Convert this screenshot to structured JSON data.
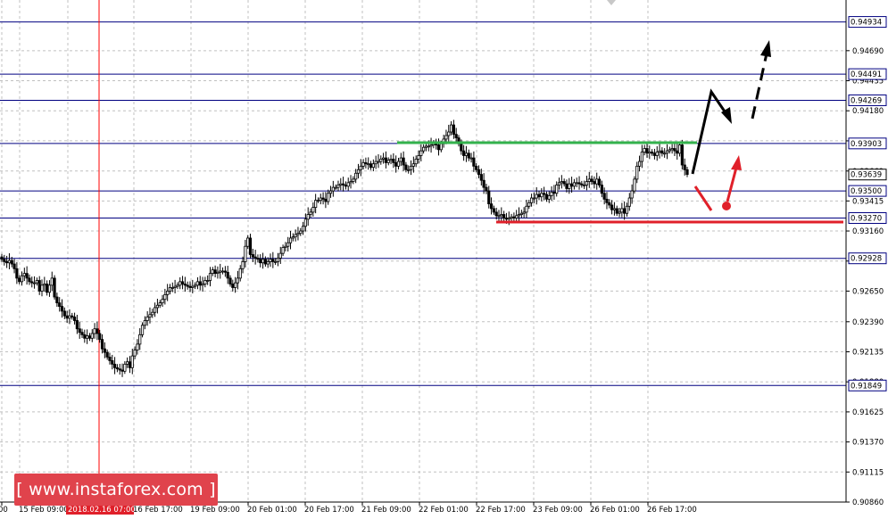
{
  "chart_data": {
    "type": "candlestick",
    "instrument_note": "",
    "watermark": "[ www.instaforex.com ]",
    "y_range": [
      0.9086,
      0.9512
    ],
    "price_ticks": [
      "0.94690",
      "0.94435",
      "0.94180",
      "0.93925",
      "0.93669",
      "0.93415",
      "0.93160",
      "0.92905",
      "0.92650",
      "0.92390",
      "0.92135",
      "0.91880",
      "0.91625",
      "0.91370",
      "0.91115",
      "0.90860"
    ],
    "time_ticks": [
      "00",
      "15 Feb 09:00",
      "2018.02.16 07:00",
      "16 Feb 17:00",
      "19 Feb 09:00",
      "20 Feb 01:00",
      "20 Feb 17:00",
      "21 Feb 09:00",
      "22 Feb 01:00",
      "22 Feb 17:00",
      "23 Feb 09:00",
      "26 Feb 01:00",
      "26 Feb 17:00"
    ],
    "highlighted_time": "2018.02.16 07:00",
    "levels": [
      {
        "price": 0.94934,
        "label": "0.94934"
      },
      {
        "price": 0.94491,
        "label": "0.94491"
      },
      {
        "price": 0.94269,
        "label": "0.94269"
      },
      {
        "price": 0.93903,
        "label": "0.93903"
      },
      {
        "price": 0.93639,
        "label": "0.93639",
        "current": true
      },
      {
        "price": 0.935,
        "label": "0.93500"
      },
      {
        "price": 0.9327,
        "label": "0.93270"
      },
      {
        "price": 0.92928,
        "label": "0.92928"
      },
      {
        "price": 0.91849,
        "label": "0.91849"
      }
    ],
    "close_series": [
      0.9292,
      0.929,
      0.9289,
      0.9291,
      0.9288,
      0.9284,
      0.9276,
      0.9273,
      0.9278,
      0.928,
      0.9276,
      0.9273,
      0.9272,
      0.9272,
      0.9274,
      0.9265,
      0.927,
      0.9271,
      0.9264,
      0.927,
      0.9276,
      0.926,
      0.9255,
      0.9252,
      0.9248,
      0.9244,
      0.9242,
      0.9244,
      0.9243,
      0.924,
      0.9233,
      0.923,
      0.9228,
      0.9225,
      0.9227,
      0.9225,
      0.9229,
      0.9233,
      0.9229,
      0.9224,
      0.9216,
      0.9213,
      0.9209,
      0.9206,
      0.9203,
      0.92,
      0.9199,
      0.9198,
      0.9197,
      0.9203,
      0.9205,
      0.92,
      0.921,
      0.9215,
      0.922,
      0.9228,
      0.9236,
      0.924,
      0.9243,
      0.9245,
      0.9247,
      0.9251,
      0.9253,
      0.9255,
      0.9258,
      0.9262,
      0.9265,
      0.9268,
      0.9268,
      0.9269,
      0.927,
      0.9273,
      0.9271,
      0.927,
      0.9269,
      0.9268,
      0.9269,
      0.927,
      0.9273,
      0.927,
      0.9271,
      0.9274,
      0.9274,
      0.928,
      0.9283,
      0.928,
      0.9281,
      0.9282,
      0.9282,
      0.9281,
      0.9276,
      0.9271,
      0.9268,
      0.9272,
      0.9276,
      0.9284,
      0.929,
      0.9303,
      0.931,
      0.9296,
      0.9294,
      0.9293,
      0.9292,
      0.9289,
      0.9292,
      0.9288,
      0.929,
      0.9292,
      0.929,
      0.929,
      0.9293,
      0.9297,
      0.9302,
      0.9303,
      0.9306,
      0.931,
      0.9311,
      0.9313,
      0.9314,
      0.9316,
      0.932,
      0.9326,
      0.933,
      0.9332,
      0.9336,
      0.9342,
      0.9342,
      0.9344,
      0.9343,
      0.9341,
      0.9348,
      0.935,
      0.9353,
      0.9353,
      0.9355,
      0.9356,
      0.9355,
      0.9354,
      0.9357,
      0.9358,
      0.936,
      0.9365,
      0.9368,
      0.9371,
      0.9374,
      0.9373,
      0.9373,
      0.937,
      0.9373,
      0.9375,
      0.9375,
      0.9377,
      0.9378,
      0.9374,
      0.9376,
      0.9377,
      0.9374,
      0.9371,
      0.9375,
      0.9378,
      0.9372,
      0.9368,
      0.9368,
      0.9371,
      0.9373,
      0.9377,
      0.938,
      0.9384,
      0.9387,
      0.9388,
      0.9388,
      0.9389,
      0.939,
      0.9389,
      0.9385,
      0.939,
      0.9394,
      0.9397,
      0.94,
      0.9406,
      0.9398,
      0.9395,
      0.939,
      0.9384,
      0.938,
      0.9382,
      0.9378,
      0.9378,
      0.9371,
      0.9368,
      0.9364,
      0.9359,
      0.9353,
      0.935,
      0.9339,
      0.9335,
      0.9332,
      0.9329,
      0.9329,
      0.933,
      0.9327,
      0.9326,
      0.9327,
      0.9328,
      0.9327,
      0.9329,
      0.933,
      0.9331,
      0.9332,
      0.9337,
      0.934,
      0.9344,
      0.9344,
      0.9347,
      0.9345,
      0.9348,
      0.9347,
      0.9343,
      0.9346,
      0.9349,
      0.9348,
      0.9355,
      0.9357,
      0.9358,
      0.9356,
      0.9352,
      0.9356,
      0.9354,
      0.9357,
      0.9357,
      0.9356,
      0.9355,
      0.9355,
      0.9358,
      0.936,
      0.9358,
      0.9356,
      0.936,
      0.9355,
      0.9348,
      0.9343,
      0.934,
      0.9338,
      0.9334,
      0.9335,
      0.9331,
      0.9332,
      0.9335,
      0.9331,
      0.9337,
      0.9344,
      0.935,
      0.936,
      0.9371,
      0.9375,
      0.9383,
      0.9386,
      0.9382,
      0.9383,
      0.9382,
      0.938,
      0.9383,
      0.9384,
      0.9382,
      0.9382,
      0.9384,
      0.9385,
      0.9386,
      0.9384,
      0.9382,
      0.9389,
      0.9372,
      0.9368,
      0.9364
    ]
  }
}
